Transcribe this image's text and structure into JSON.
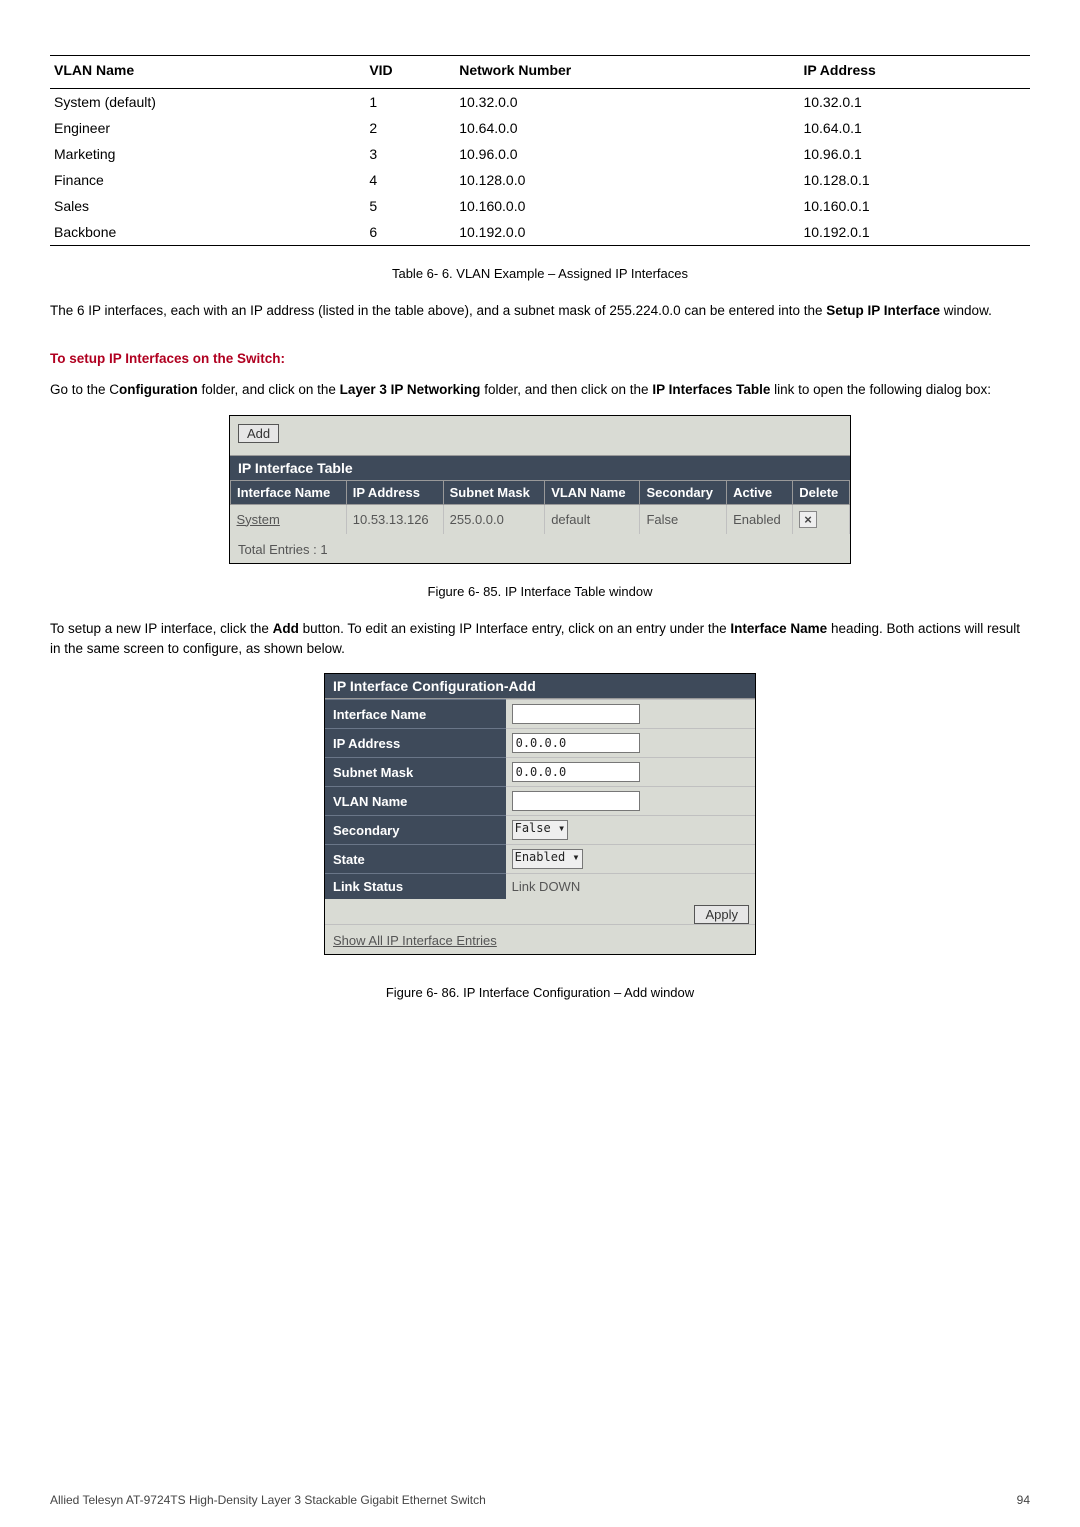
{
  "vlan_table": {
    "headers": [
      "VLAN Name",
      "VID",
      "Network Number",
      "IP Address"
    ],
    "rows": [
      {
        "name": "System (default)",
        "vid": "1",
        "net": "10.32.0.0",
        "ip": "10.32.0.1"
      },
      {
        "name": "Engineer",
        "vid": "2",
        "net": "10.64.0.0",
        "ip": "10.64.0.1"
      },
      {
        "name": "Marketing",
        "vid": "3",
        "net": "10.96.0.0",
        "ip": "10.96.0.1"
      },
      {
        "name": "Finance",
        "vid": "4",
        "net": "10.128.0.0",
        "ip": "10.128.0.1"
      },
      {
        "name": "Sales",
        "vid": "5",
        "net": "10.160.0.0",
        "ip": "10.160.0.1"
      },
      {
        "name": "Backbone",
        "vid": "6",
        "net": "10.192.0.0",
        "ip": "10.192.0.1"
      }
    ],
    "caption": "Table 6- 6. VLAN Example – Assigned IP Interfaces"
  },
  "para1": {
    "pre": "The 6 IP interfaces, each with an IP address (listed in the table above), and a subnet mask of 255.224.0.0 can be entered into the ",
    "bold": "Setup IP Interface",
    "post": " window."
  },
  "section_heading": "To setup IP Interfaces on the Switch:",
  "para2": {
    "t1": "Go to the C",
    "b1": "onfiguration",
    "t2": " folder, and click on the ",
    "b2": "Layer 3 IP Networking",
    "t3": " folder, and then click on the ",
    "b3": "IP Interfaces Table",
    "t4": " link to open the following dialog box:"
  },
  "fig1": {
    "add_label": "Add",
    "title": "IP Interface Table",
    "headers": [
      "Interface Name",
      "IP Address",
      "Subnet Mask",
      "VLAN Name",
      "Secondary",
      "Active",
      "Delete"
    ],
    "row": {
      "iface": "System",
      "ip": "10.53.13.126",
      "mask": "255.0.0.0",
      "vlan": "default",
      "secondary": "False",
      "active": "Enabled",
      "del": "×"
    },
    "footer": "Total Entries : 1",
    "caption": "Figure 6- 85. IP Interface Table window"
  },
  "para3": {
    "t1": "To setup a new IP interface, click the ",
    "b1": "Add",
    "t2": " button. To edit an existing IP Interface entry, click on an entry under the ",
    "b2": "Interface Name",
    "t3": " heading. Both actions will result in the same screen to configure, as shown below."
  },
  "fig2": {
    "title": "IP Interface Configuration-Add",
    "rows": {
      "iface_label": "Interface Name",
      "iface_value": "",
      "ip_label": "IP Address",
      "ip_value": "0.0.0.0",
      "mask_label": "Subnet Mask",
      "mask_value": "0.0.0.0",
      "vlan_label": "VLAN Name",
      "vlan_value": "",
      "secondary_label": "Secondary",
      "secondary_value": "False",
      "state_label": "State",
      "state_value": "Enabled",
      "link_label": "Link Status",
      "link_value": "Link DOWN"
    },
    "apply": "Apply",
    "footer": "Show All IP Interface Entries",
    "caption": "Figure 6- 86. IP Interface Configuration – Add window"
  },
  "footer": {
    "left": "Allied Telesyn AT-9724TS High-Density Layer 3 Stackable Gigabit Ethernet Switch",
    "right": "94"
  }
}
